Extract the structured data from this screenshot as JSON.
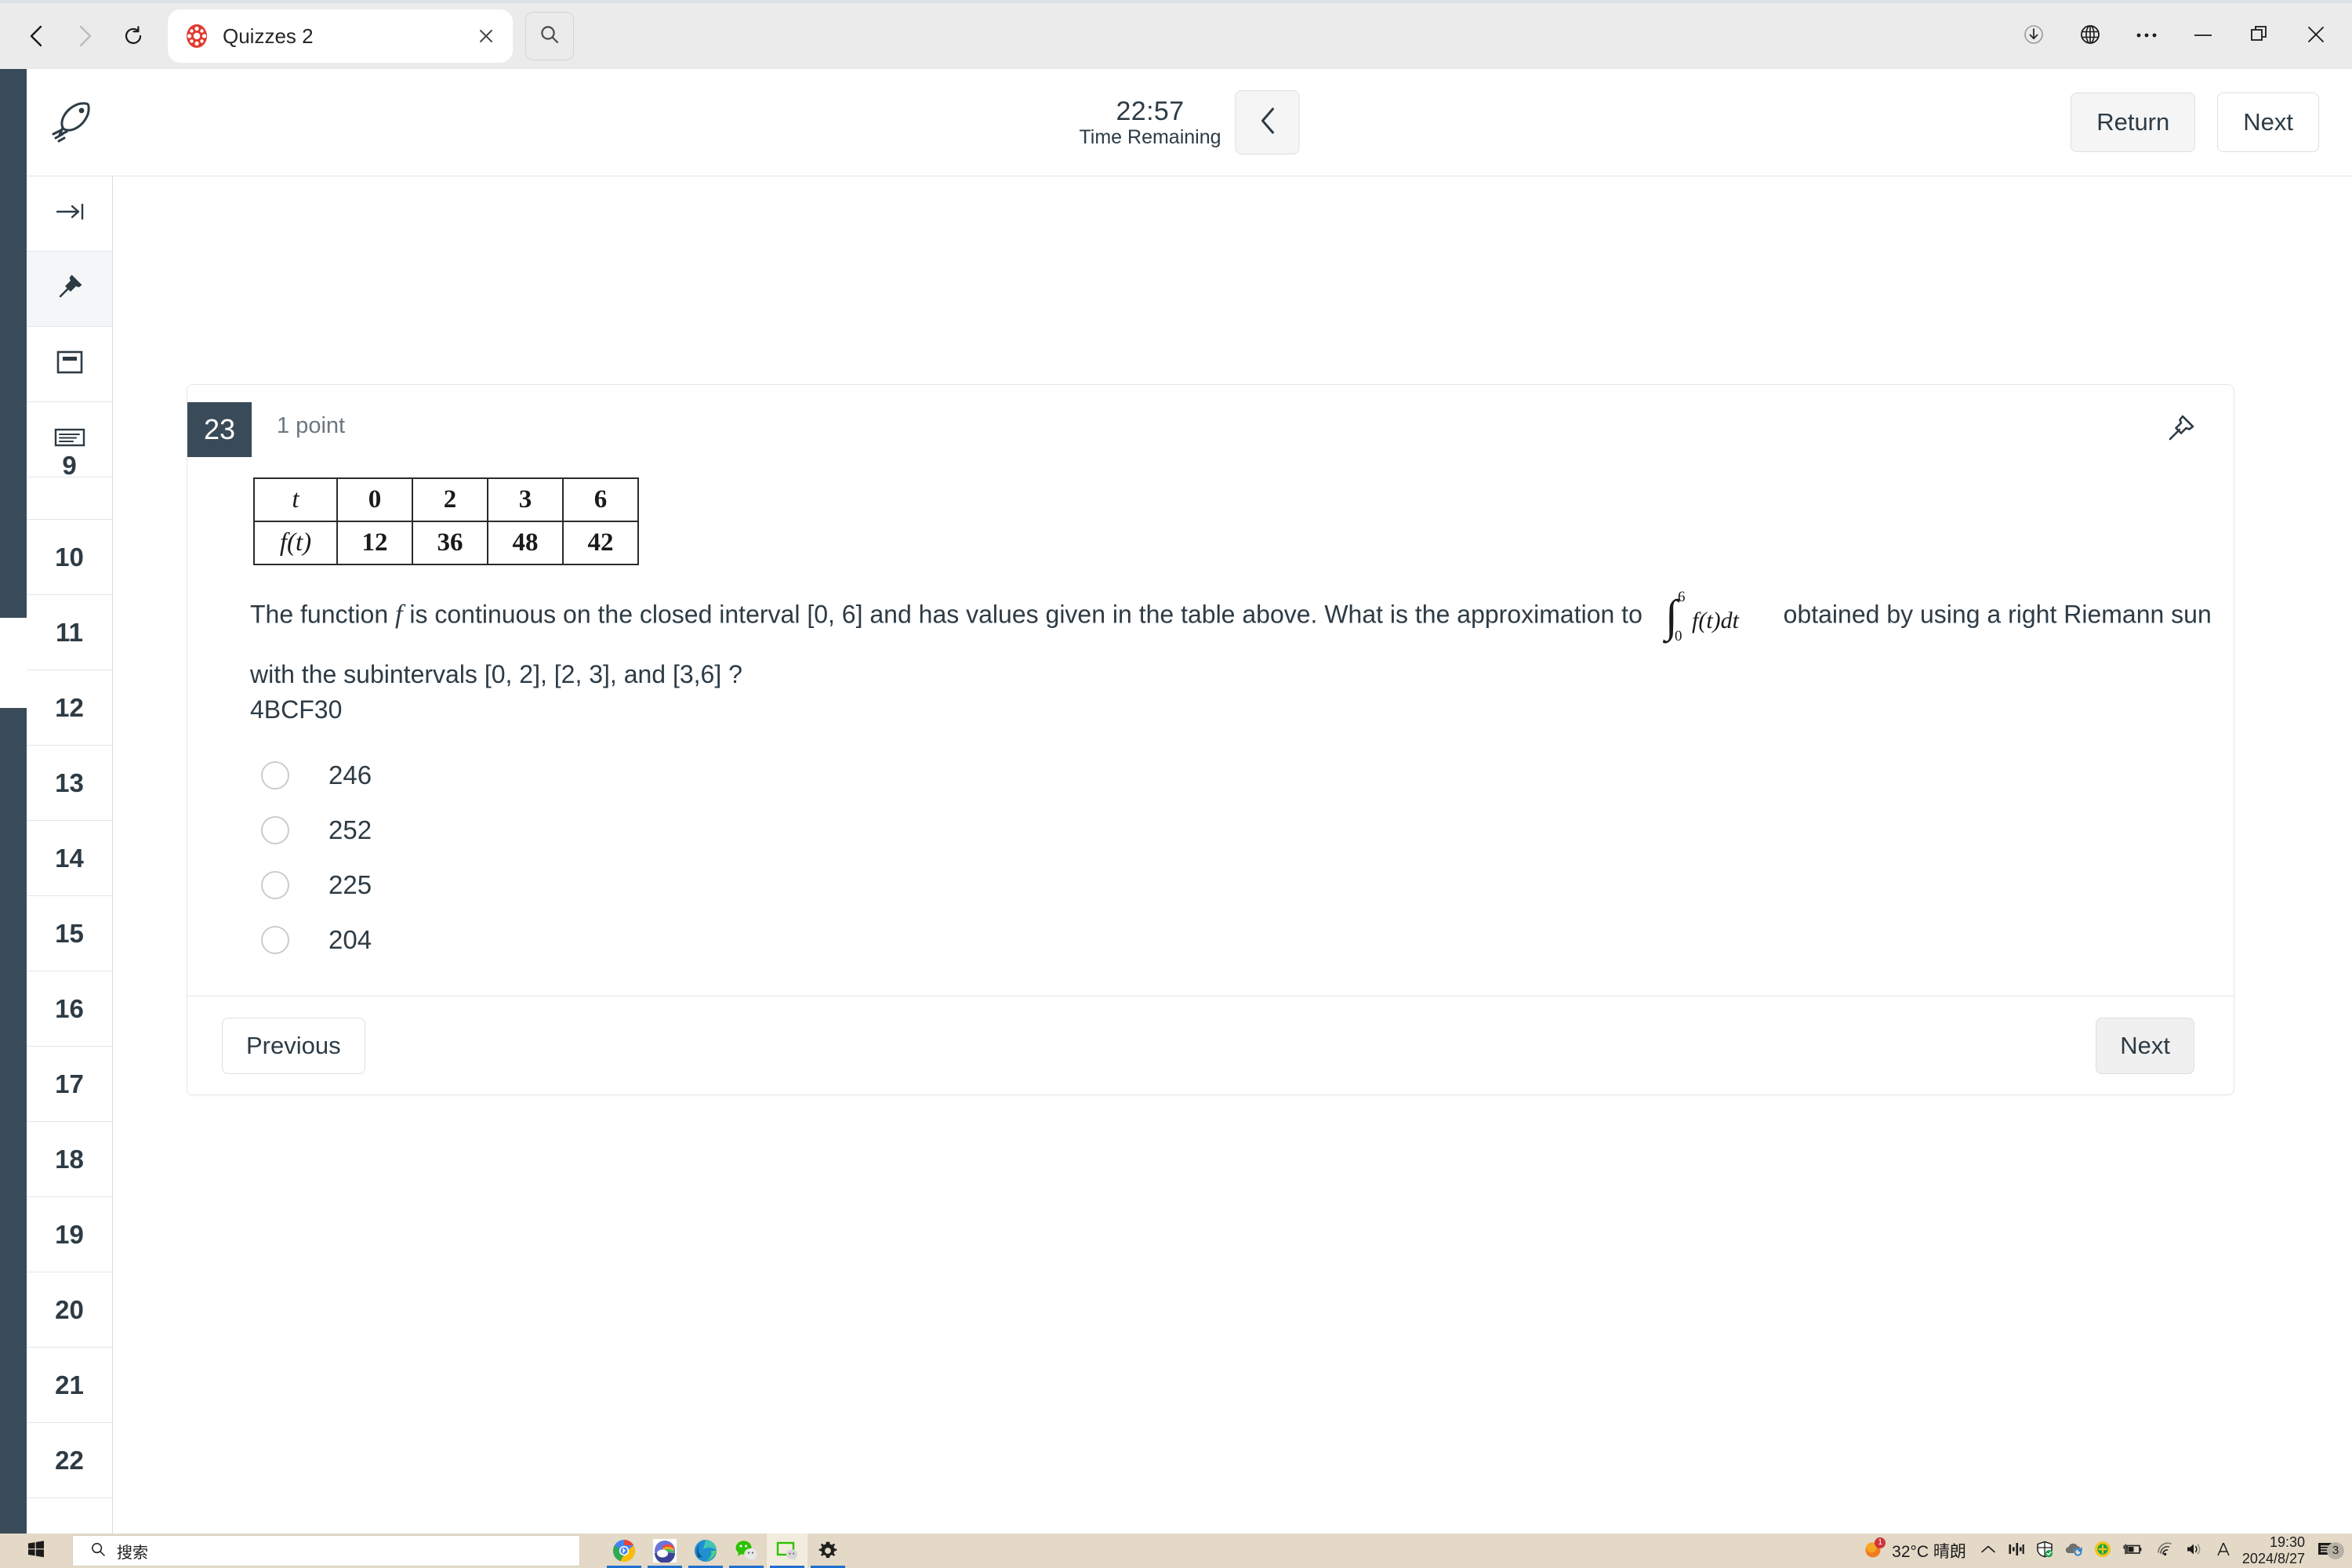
{
  "browser": {
    "back_icon": "back-arrow-icon",
    "forward_icon": "forward-arrow-icon",
    "reload_icon": "reload-icon",
    "tab": {
      "title": "Quizzes 2",
      "favicon": "canvas-logo-icon",
      "close_icon": "close-icon"
    },
    "tab_search_icon": "search-icon",
    "window_controls": {
      "downloads_icon": "download-icon",
      "translate_icon": "globe-icon",
      "more_icon": "more-options-icon",
      "minimize_icon": "minimize-icon",
      "maximize_icon": "restore-icon",
      "close_icon": "close-icon"
    }
  },
  "quiz_header": {
    "logo_icon": "rocket-icon",
    "timer_value": "22:57",
    "timer_label": "Time Remaining",
    "collapse_icon": "chevron-left-icon",
    "return_label": "Return",
    "next_label": "Next"
  },
  "sidebar": {
    "tool_icons": [
      {
        "name": "collapse-panel-icon",
        "glyph": "arrow-to-bar"
      },
      {
        "name": "pin-icon",
        "glyph": "pushpin-filled"
      },
      {
        "name": "card-view-icon",
        "glyph": "card"
      },
      {
        "name": "list-view-icon",
        "glyph": "list"
      }
    ],
    "question_numbers": [
      "9",
      "10",
      "11",
      "12",
      "13",
      "14",
      "15",
      "16",
      "17",
      "18",
      "19",
      "20",
      "21",
      "22"
    ]
  },
  "question": {
    "number": "23",
    "points": "1 point",
    "flag_icon": "pushpin-outline-icon",
    "table": {
      "row_labels": [
        "t",
        "f(t)"
      ],
      "t_values": [
        "0",
        "2",
        "3",
        "6"
      ],
      "f_values": [
        "12",
        "36",
        "48",
        "42"
      ]
    },
    "text_part1": "The function",
    "math_f": "f",
    "text_part2": "is continuous on the closed interval [0, 6] and has values given in the table above. What is the approximation to",
    "integral": {
      "lower": "0",
      "upper": "6",
      "integrand": "f(t)dt"
    },
    "text_part3": "obtained by using a right Riemann sun",
    "text_line2": "with the subintervals [0, 2], [2, 3], and [3,6] ?",
    "code_line": "4BCF30",
    "options": [
      {
        "label": "246",
        "selected": false
      },
      {
        "label": "252",
        "selected": false
      },
      {
        "label": "225",
        "selected": false
      },
      {
        "label": "204",
        "selected": false
      }
    ],
    "previous_label": "Previous",
    "next_label": "Next"
  },
  "taskbar": {
    "start_icon": "windows-start-icon",
    "search_placeholder": "搜索",
    "search_icon": "search-icon",
    "apps": [
      {
        "name": "chrome-icon",
        "active": false
      },
      {
        "name": "weather-app-icon",
        "active": false
      },
      {
        "name": "edge-icon",
        "active": false
      },
      {
        "name": "wechat-icon",
        "active": false
      },
      {
        "name": "wechat-desktop-icon",
        "active": true
      },
      {
        "name": "settings-gear-icon",
        "active": false
      }
    ],
    "weather": {
      "badge": "1",
      "text": "32°C  晴朗",
      "icon": "sun-icon"
    },
    "tray_icons": [
      "chevron-up-icon",
      "network-monitor-icon",
      "security-shield-icon",
      "onedrive-sync-icon",
      "update-icon",
      "battery-charging-icon",
      "wifi-icon",
      "volume-icon",
      "ime-letter-icon"
    ],
    "clock": {
      "time": "19:30",
      "date": "2024/8/27"
    },
    "notifications": {
      "icon": "notifications-icon",
      "count": "3"
    }
  },
  "colors": {
    "canvas_dark": "#394b59",
    "text": "#2d3b45",
    "muted": "#6b7780",
    "taskbar_bg": "#e3d9c6"
  }
}
